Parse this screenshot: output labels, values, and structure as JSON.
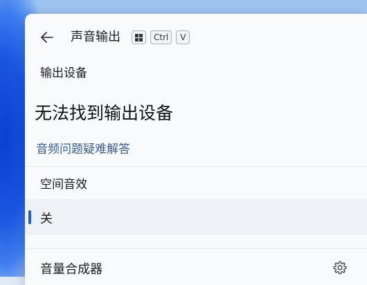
{
  "header": {
    "title": "声音输出",
    "back_icon": "arrow-left-icon",
    "shortcut": {
      "win_icon": "windows-key-icon",
      "ctrl": "Ctrl",
      "v": "V"
    }
  },
  "output_device": {
    "label": "输出设备",
    "message": "无法找到输出设备",
    "troubleshoot_link": "音频问题疑难解答"
  },
  "spatial_audio": {
    "label": "空间音效",
    "selected_option": "关"
  },
  "mixer": {
    "label": "音量合成器",
    "settings_icon": "gear-icon"
  },
  "colors": {
    "accent": "#1565c0",
    "link": "#3a5e8c",
    "panel_bg": "#f7f9fb"
  }
}
